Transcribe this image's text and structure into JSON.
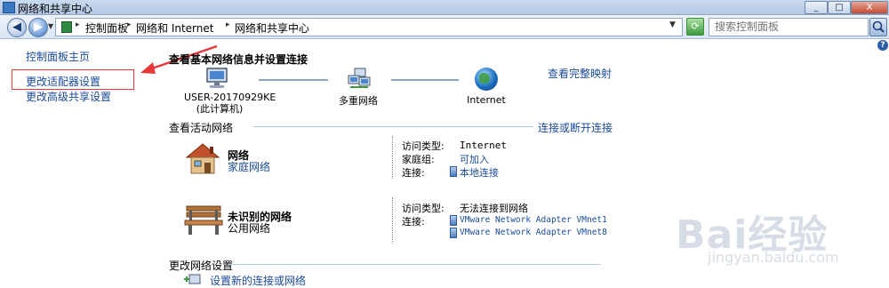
{
  "window": {
    "title": "网络和共享中心",
    "min_label": "_",
    "max_label": "□",
    "close_label": "X"
  },
  "address": {
    "back_label": "◀",
    "forward_label": "▶",
    "breadcrumbs": [
      "控制面板",
      "网络和 Internet",
      "网络和共享中心"
    ],
    "search_placeholder": "搜索控制面板"
  },
  "help": {
    "label": "?"
  },
  "sidebar": {
    "items": [
      {
        "label": "控制面板主页"
      },
      {
        "label": "更改适配器设置"
      },
      {
        "label": "更改高级共享设置"
      }
    ]
  },
  "main": {
    "heading": "查看基本网络信息并设置连接",
    "full_map_link": "查看完整映射",
    "nodes": [
      {
        "label": "USER-20170929KE",
        "sublabel": "(此计算机)"
      },
      {
        "label": "多重网络"
      },
      {
        "label": "Internet"
      }
    ],
    "active_title": "查看活动网络",
    "connect_link": "连接或断开连接",
    "networks": [
      {
        "name": "网络",
        "type": "家庭网络",
        "props": [
          {
            "label": "访问类型:",
            "value": "Internet"
          },
          {
            "label": "家庭组:",
            "value": "可加入"
          },
          {
            "label": "连接:",
            "value": "本地连接"
          }
        ]
      },
      {
        "name": "未识别的网络",
        "type": "公用网络",
        "props": [
          {
            "label": "访问类型:",
            "value": "无法连接到网络"
          },
          {
            "label": "连接:",
            "value": "VMware Network Adapter VMnet1"
          },
          {
            "label": "",
            "value": "VMware Network Adapter VMnet8"
          }
        ]
      }
    ],
    "change_settings_title": "更改网络设置",
    "setup_link": "设置新的连接或网络"
  },
  "watermark": {
    "text": "Bai经验",
    "sub": "jingyan.baidu.com"
  },
  "colors": {
    "link": "#1a4a9a",
    "highlight": "#e8383a",
    "line": "#8aa2c4"
  }
}
